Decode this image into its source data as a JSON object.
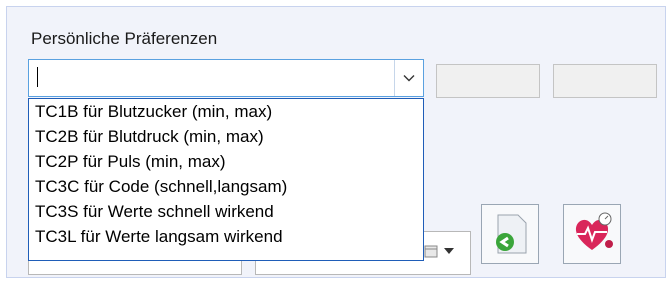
{
  "section": {
    "label": "Persönliche Präferenzen"
  },
  "combo": {
    "value": ""
  },
  "dropdown": {
    "items": [
      "TC1B für Blutzucker (min, max)",
      "TC2B für Blutdruck (min, max)",
      "TC2P für Puls (min, max)",
      "TC3C für Code (schnell,langsam)",
      "TC3S für Werte schnell wirkend",
      "TC3L für Werte langsam wirkend"
    ]
  },
  "colors": {
    "accent": "#1f5db8",
    "panel_bg": "#f1f3fa",
    "green": "#3aa53a",
    "heart": "#d9265a"
  },
  "icons": [
    "chevron-down-icon",
    "calendar-icon",
    "document-arrow-icon",
    "heart-gauge-icon"
  ]
}
